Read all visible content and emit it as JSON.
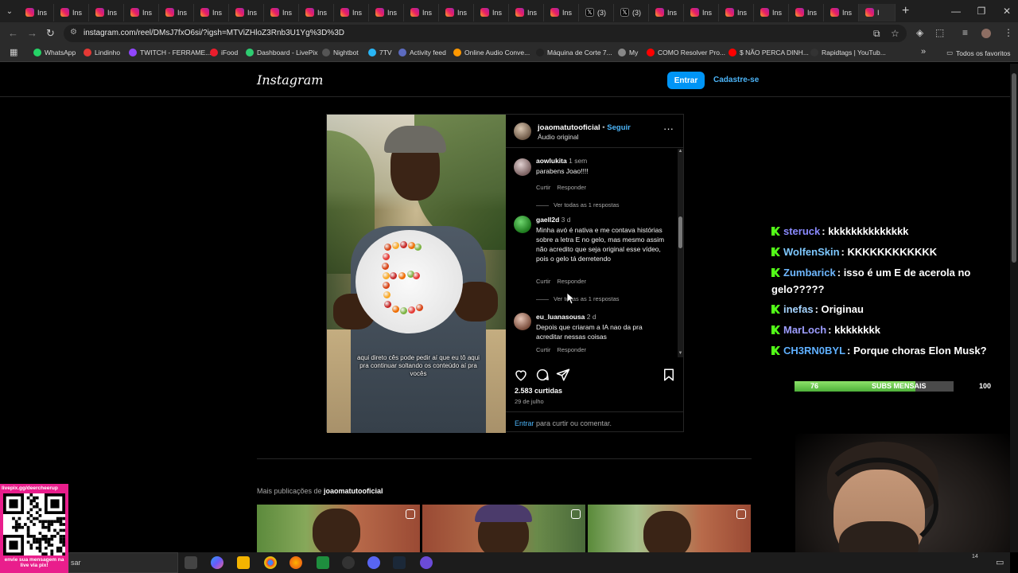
{
  "browser": {
    "tabs": [
      {
        "label": "Ins",
        "icon": "instagram-icon"
      },
      {
        "label": "Ins",
        "icon": "instagram-icon"
      },
      {
        "label": "Ins",
        "icon": "instagram-icon"
      },
      {
        "label": "Ins",
        "icon": "instagram-icon"
      },
      {
        "label": "Ins",
        "icon": "instagram-icon"
      },
      {
        "label": "Ins",
        "icon": "instagram-icon"
      },
      {
        "label": "Ins",
        "icon": "instagram-icon"
      },
      {
        "label": "Ins",
        "icon": "instagram-icon"
      },
      {
        "label": "Ins",
        "icon": "instagram-icon"
      },
      {
        "label": "Ins",
        "icon": "instagram-icon"
      },
      {
        "label": "Ins",
        "icon": "instagram-icon"
      },
      {
        "label": "Ins",
        "icon": "instagram-icon"
      },
      {
        "label": "Ins",
        "icon": "instagram-icon"
      },
      {
        "label": "Ins",
        "icon": "instagram-icon"
      },
      {
        "label": "Ins",
        "icon": "instagram-icon"
      },
      {
        "label": "Ins",
        "icon": "instagram-icon"
      },
      {
        "label": "(3)",
        "icon": "x-icon"
      },
      {
        "label": "(3)",
        "icon": "x-icon"
      },
      {
        "label": "Ins",
        "icon": "instagram-icon"
      },
      {
        "label": "Ins",
        "icon": "instagram-icon"
      },
      {
        "label": "Ins",
        "icon": "instagram-icon"
      },
      {
        "label": "Ins",
        "icon": "instagram-icon"
      },
      {
        "label": "Ins",
        "icon": "instagram-icon"
      },
      {
        "label": "Ins",
        "icon": "instagram-icon"
      },
      {
        "label": "I",
        "icon": "instagram-icon"
      }
    ],
    "url": "instagram.com/reel/DMsJ7fxO6si/?igsh=MTViZHloZ3Rnb3U1Yg%3D%3D",
    "bookmarks": [
      {
        "label": "WhatsApp",
        "color": "#25d366"
      },
      {
        "label": "Lindinho",
        "color": "#e53935"
      },
      {
        "label": "TWITCH - FERRAME...",
        "color": "#9146ff"
      },
      {
        "label": "iFood",
        "color": "#ea1d2c"
      },
      {
        "label": "Dashboard - LivePix",
        "color": "#2ecc71"
      },
      {
        "label": "Nightbot",
        "color": "#555"
      },
      {
        "label": "7TV",
        "color": "#29b6f6"
      },
      {
        "label": "Activity feed",
        "color": "#5c6bc0"
      },
      {
        "label": "Online Audio Conve...",
        "color": "#ff9800"
      },
      {
        "label": "Máquina de Corte 7...",
        "color": "#222"
      },
      {
        "label": "My",
        "color": "#888"
      },
      {
        "label": "COMO Resolver Pro...",
        "color": "#ff0000"
      },
      {
        "label": "$ NÃO PERCA DINH...",
        "color": "#ff0000"
      },
      {
        "label": "Rapidtags | YouTub...",
        "color": "#333"
      }
    ],
    "all_bookmarks": "Todos os favoritos"
  },
  "instagram": {
    "logo": "Instagram",
    "login": "Entrar",
    "signup": "Cadastre-se",
    "post": {
      "username": "joaomatutooficial",
      "separator": " • ",
      "follow": "Seguir",
      "audio": "Áudio original",
      "more": "···",
      "caption": "aqui direto cês pode pedir aí que eu tô aqui pra continuar soltando os conteúdo aí pra vocês",
      "comments": [
        {
          "user": "aowlukita",
          "time": "1 sem",
          "text": "parabens Joao!!!!",
          "like": "Curtir",
          "reply": "Responder",
          "replies": "Ver todas as 1 respostas"
        },
        {
          "user": "gaell2d",
          "time": "3 d",
          "text": "Minha avó é nativa e me contava histórias sobre a letra E no gelo, mas mesmo assim não acredito que seja original esse vídeo, pois o gelo tá derretendo",
          "like": "Curtir",
          "reply": "Responder",
          "replies": "Ver todas as 1 respostas"
        },
        {
          "user": "eu_luanasousa",
          "time": "2 d",
          "text": "Depois que criaram a IA nao da pra acreditar nessas coisas",
          "like": "Curtir",
          "reply": "Responder"
        }
      ],
      "likes": "2.583 curtidas",
      "date": "29 de julho",
      "login_link": "Entrar",
      "login_rest": " para curtir ou comentar."
    },
    "more_posts_prefix": "Mais publicações de ",
    "more_posts_user": "joaomatutooficial"
  },
  "chat": [
    {
      "user": "steruck",
      "color": "#8a8aff",
      "message": ": kkkkkkkkkkkkkk"
    },
    {
      "user": "WolfenSkin",
      "color": "#7ec8ff",
      "message": ": KKKKKKKKKKKK"
    },
    {
      "user": "Zumbarick",
      "color": "#6fb8ff",
      "message": ": isso é um E de acerola no gelo?????"
    },
    {
      "user": "inefas",
      "color": "#a6d4ff",
      "message": ": Originau"
    },
    {
      "user": "MarLoch",
      "color": "#9d9dff",
      "message": ": kkkkkkkk"
    },
    {
      "user": "CH3RN0BYL",
      "color": "#5fb0ff",
      "message": ": Porque choras Elon Musk?"
    }
  ],
  "subs_goal": {
    "label": "SUBS MENSAIS",
    "current": "76",
    "goal": "100",
    "progress": 0.76
  },
  "qr": {
    "top": "livepix.gg/deercheerup",
    "bottom": "envie sua mensagem na live via pix!"
  },
  "taskbar": {
    "search": "sar",
    "clock": "14"
  }
}
